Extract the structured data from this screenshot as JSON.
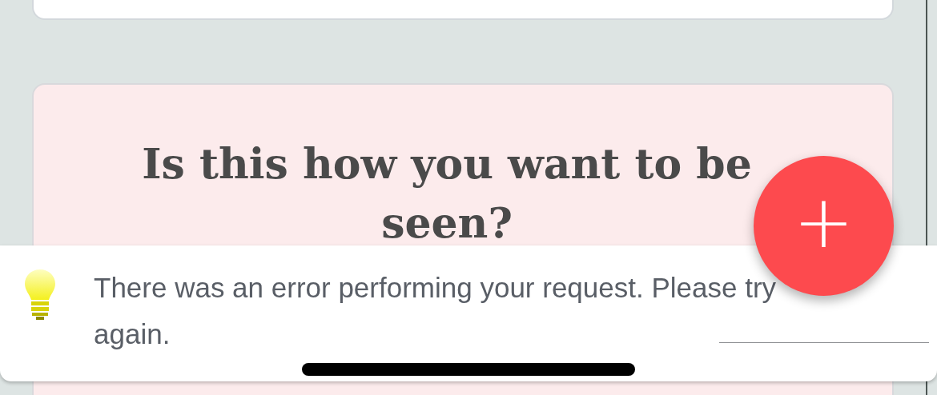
{
  "prompt_card": {
    "heading": "Is this how you want to be seen?"
  },
  "fab": {
    "label": "+"
  },
  "toast": {
    "message": "There was an error performing your request. Please try again."
  }
}
